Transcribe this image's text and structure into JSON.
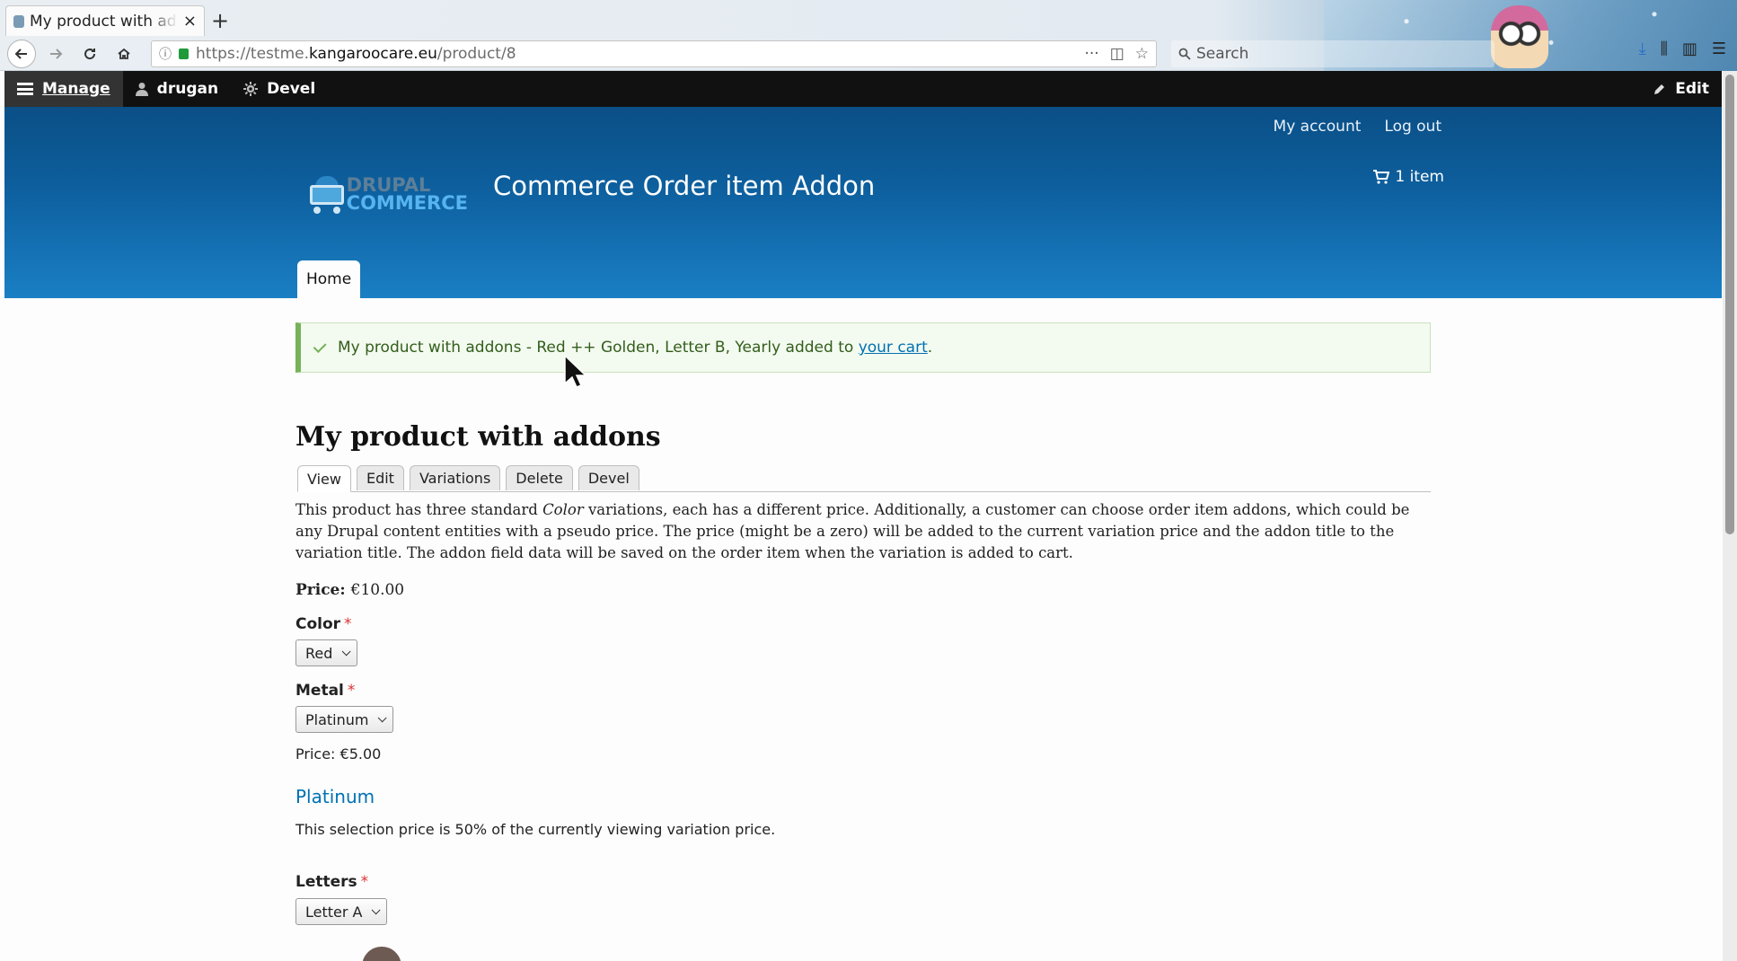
{
  "browser": {
    "tab_title": "My product with addons",
    "url_prefix": "https://testme.",
    "url_domain": "kangaroocare.eu",
    "url_path": "/product/8",
    "search_placeholder": "Search",
    "new_tab_label": "+",
    "close_tab_label": "×",
    "page_actions": "···"
  },
  "admin_toolbar": {
    "manage_label": "Manage",
    "user_label": "drugan",
    "devel_label": "Devel",
    "edit_label": "Edit"
  },
  "header": {
    "my_account": "My account",
    "log_out": "Log out",
    "logo_line1": "DRUPAL",
    "logo_line2": "COMMERCE",
    "site_name": "Commerce Order item Addon",
    "cart_count": "1 item",
    "nav_home": "Home"
  },
  "message": {
    "text": "My product with addons - Red ++ Golden, Letter B, Yearly added to ",
    "link": "your cart",
    "suffix": "."
  },
  "product": {
    "title": "My product with addons",
    "tabs": [
      "View",
      "Edit",
      "Variations",
      "Delete",
      "Devel"
    ],
    "description_1": "This product has three  standard ",
    "description_em": "Color",
    "description_2": " variations, each has a different price. Additionally, a customer can choose order item addons, which could be any Drupal content entities with a pseudo price. The price (might be a zero) will be added to the current variation price and the addon title to the variation title. The addon field data will be saved on the order item when the variation is added to cart.",
    "price_label": "Price:",
    "price_value": "€10.00",
    "color_label": "Color",
    "color_value": "Red",
    "metal_label": "Metal",
    "metal_value": "Platinum",
    "addon_price": "Price: €5.00",
    "addon_title": "Platinum",
    "addon_desc": "This selection price is 50% of the currently viewing variation price.",
    "letters_label": "Letters",
    "letters_value": "Letter A",
    "required_mark": "*"
  }
}
